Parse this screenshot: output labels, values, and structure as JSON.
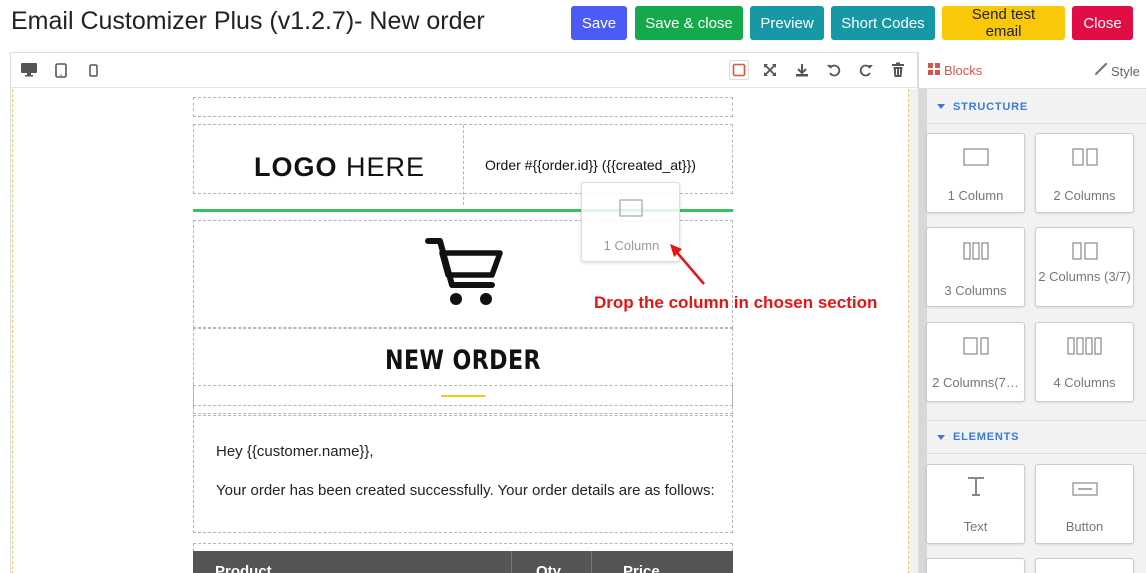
{
  "header": {
    "title": "Email Customizer Plus (v1.2.7)- New order",
    "buttons": {
      "save": "Save",
      "save_close": "Save & close",
      "preview": "Preview",
      "short_codes": "Short Codes",
      "send_test": "Send test email",
      "close": "Close"
    }
  },
  "toolbar": {
    "devices": [
      "desktop-icon",
      "tablet-icon",
      "mobile-icon"
    ],
    "actions": [
      "border-toggle-icon",
      "fullscreen-icon",
      "download-icon",
      "undo-icon",
      "redo-icon",
      "trash-icon"
    ]
  },
  "email": {
    "logo_bold": "LOGO",
    "logo_rest": " HERE",
    "order_line": "Order #{{order.id}} ({{created_at}})",
    "heading": "NEW ORDER",
    "greeting": "Hey {{customer.name}},",
    "message": "Your order has been created successfully. Your order details are as follows:",
    "table_headers": [
      "Product",
      "Qty",
      "Price"
    ]
  },
  "drag": {
    "ghost_label": "1 Column",
    "note": "Drop the column in chosen section"
  },
  "panel": {
    "tabs": {
      "blocks": "Blocks",
      "style": "Style"
    },
    "structure_title": "STRUCTURE",
    "structure_blocks": [
      {
        "label": "1 Column"
      },
      {
        "label": "2 Columns"
      },
      {
        "label": "3 Columns"
      },
      {
        "label": "2 Columns (3/7)"
      },
      {
        "label": "2 Columns(7…"
      },
      {
        "label": "4 Columns"
      }
    ],
    "elements_title": "ELEMENTS",
    "element_blocks": [
      {
        "label": "Text"
      },
      {
        "label": "Button"
      }
    ]
  },
  "colors": {
    "save": "#4b5cf6",
    "save_close": "#14a94a",
    "preview": "#1798a7",
    "send_test": "#f8c809",
    "close": "#e10e46",
    "accent_blue": "#3a7bd5",
    "drop_note": "#e81313"
  }
}
